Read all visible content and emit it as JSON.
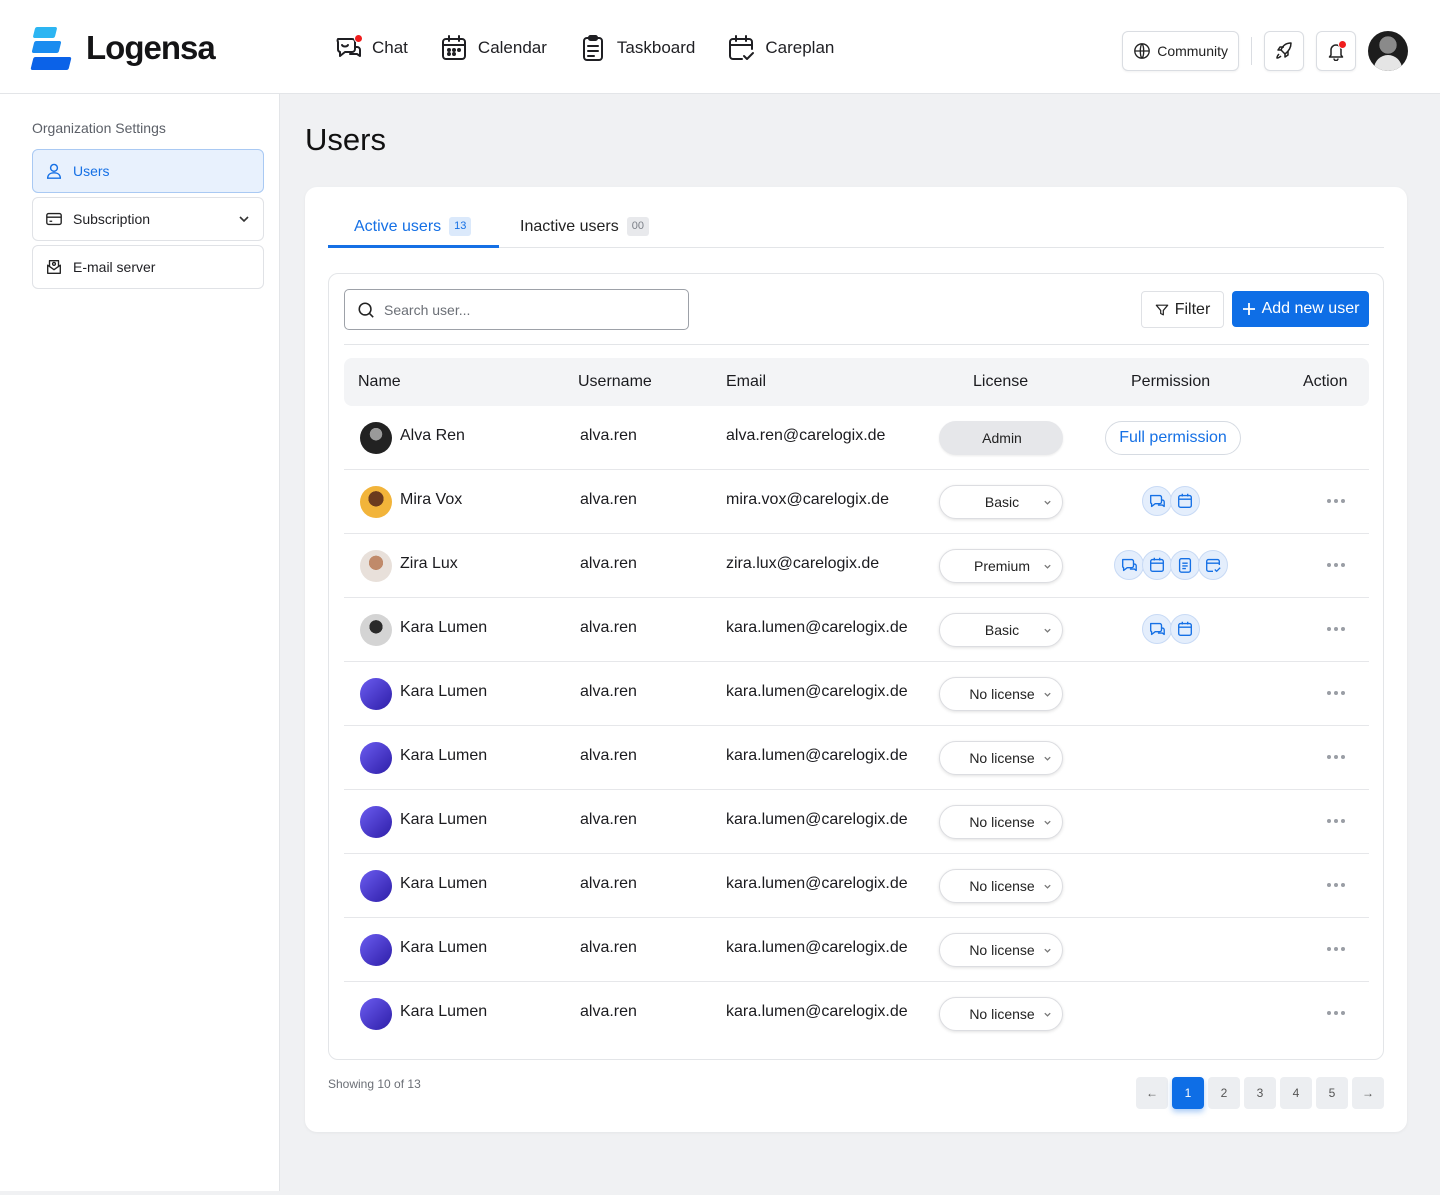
{
  "app": {
    "name": "Logensa"
  },
  "nav": [
    {
      "label": "Chat",
      "icon": "chat-icon",
      "has_notification": true
    },
    {
      "label": "Calendar",
      "icon": "calendar-icon",
      "has_notification": false
    },
    {
      "label": "Taskboard",
      "icon": "clipboard-icon",
      "has_notification": false
    },
    {
      "label": "Careplan",
      "icon": "calendar-check-icon",
      "has_notification": false
    }
  ],
  "header": {
    "community_label": "Community"
  },
  "sidebar": {
    "title": "Organization Settings",
    "items": [
      {
        "label": "Users",
        "icon": "user-icon",
        "active": true
      },
      {
        "label": "Subscription",
        "icon": "credit-card-icon",
        "active": false
      },
      {
        "label": "E-mail server",
        "icon": "mail-server-icon",
        "active": false
      }
    ]
  },
  "page": {
    "title": "Users"
  },
  "tabs": [
    {
      "label": "Active users",
      "count": "13"
    },
    {
      "label": "Inactive users",
      "count": "00"
    }
  ],
  "toolbar": {
    "search_placeholder": "Search user...",
    "filter_label": "Filter",
    "add_label": "Add new user"
  },
  "table": {
    "columns": [
      "Name",
      "Username",
      "Email",
      "License",
      "Permission",
      "Action"
    ],
    "rows": [
      {
        "name": "Alva Ren",
        "username": "alva.ren",
        "email": "alva.ren@carelogix.de",
        "license": "Admin",
        "permission": "Full permission"
      },
      {
        "name": "Mira Vox",
        "username": "alva.ren",
        "email": "mira.vox@carelogix.de",
        "license": "Basic",
        "permission": ""
      },
      {
        "name": "Zira Lux",
        "username": "alva.ren",
        "email": "zira.lux@carelogix.de",
        "license": "Premium",
        "permission": ""
      },
      {
        "name": "Kara Lumen",
        "username": "alva.ren",
        "email": "kara.lumen@carelogix.de",
        "license": "Basic",
        "permission": ""
      },
      {
        "name": "Kara Lumen",
        "username": "alva.ren",
        "email": "kara.lumen@carelogix.de",
        "license": "No license",
        "permission": ""
      },
      {
        "name": "Kara Lumen",
        "username": "alva.ren",
        "email": "kara.lumen@carelogix.de",
        "license": "No license",
        "permission": ""
      },
      {
        "name": "Kara Lumen",
        "username": "alva.ren",
        "email": "kara.lumen@carelogix.de",
        "license": "No license",
        "permission": ""
      },
      {
        "name": "Kara Lumen",
        "username": "alva.ren",
        "email": "kara.lumen@carelogix.de",
        "license": "No license",
        "permission": ""
      },
      {
        "name": "Kara Lumen",
        "username": "alva.ren",
        "email": "kara.lumen@carelogix.de",
        "license": "No license",
        "permission": ""
      },
      {
        "name": "Kara Lumen",
        "username": "alva.ren",
        "email": "kara.lumen@carelogix.de",
        "license": "No license",
        "permission": ""
      }
    ]
  },
  "footer": {
    "showing": "Showing 10 of 13",
    "pages": [
      "1",
      "2",
      "3",
      "4",
      "5"
    ],
    "current_page": "1",
    "prev": "←",
    "next": "→"
  },
  "colors": {
    "accent": "#0e6ee6",
    "notification": "#f01d1d"
  }
}
